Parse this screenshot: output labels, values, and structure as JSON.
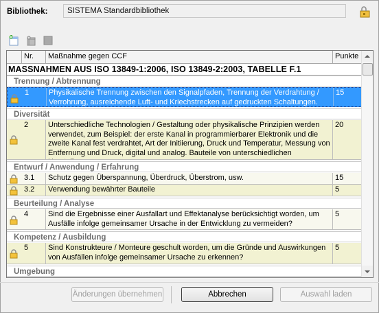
{
  "library": {
    "label": "Bibliothek:",
    "value": "SISTEMA Standardbibliothek"
  },
  "grid": {
    "headers": [
      "",
      "Nr.",
      "Maßnahme gegen CCF",
      "Punkte"
    ],
    "table_title": "MASSNAHMEN AUS ISO 13849-1:2006, ISO 13849-2:2003, TABELLE F.1",
    "groups": [
      "Trennung / Abtrennung",
      "Diversität",
      "Entwurf / Anwendung / Erfahrung",
      "Beurteilung / Analyse",
      "Kompetenz / Ausbildung",
      "Umgebung"
    ],
    "rows": [
      {
        "nr": "1",
        "text": "Physikalische Trennung zwischen den Signalpfaden, Trennung der Verdrahtung / Verrohrung, ausreichende Luft- und Kriechstrecken auf gedruckten Schaltungen.",
        "points": "15"
      },
      {
        "nr": "2",
        "text": "Unterschiedliche Technologien / Gestaltung oder physikalische Prinzipien werden verwendet, zum Beispiel: der erste Kanal in programmierbarer Elektronik und die zweite Kanal fest verdrahtet, Art der Initiierung, Druck und Temperatur, Messung von Entfernung und Druck, digital und analog. Bauteile von unterschiedlichen Herstellern.",
        "points": "20"
      },
      {
        "nr": "3.1",
        "text": "Schutz gegen Überspannung, Überdruck, Überstrom, usw.",
        "points": "15"
      },
      {
        "nr": "3.2",
        "text": "Verwendung bewährter Bauteile",
        "points": "5"
      },
      {
        "nr": "4",
        "text": "Sind die Ergebnisse einer Ausfallart und Effektanalyse berücksichtigt worden, um Ausfälle infolge gemeinsamer Ursache in der Entwicklung zu vermeiden?",
        "points": "5"
      },
      {
        "nr": "5",
        "text": "Sind Konstrukteure / Monteure geschult worden, um die Gründe und Auswirkungen von Ausfällen infolge gemeinsamer Ursache zu erkennen?",
        "points": "5"
      }
    ]
  },
  "buttons": {
    "apply": "Änderungen übernehmen",
    "cancel": "Abbrechen",
    "load": "Auswahl laden"
  },
  "icons": [
    "lock-folder-icon",
    "add-icon",
    "add-child-icon",
    "delete-icon",
    "lock-icon"
  ],
  "colors": {
    "selection": "#3399ff",
    "row_highlight": "#f2f2d2",
    "group_text": "#6e6e6e"
  }
}
